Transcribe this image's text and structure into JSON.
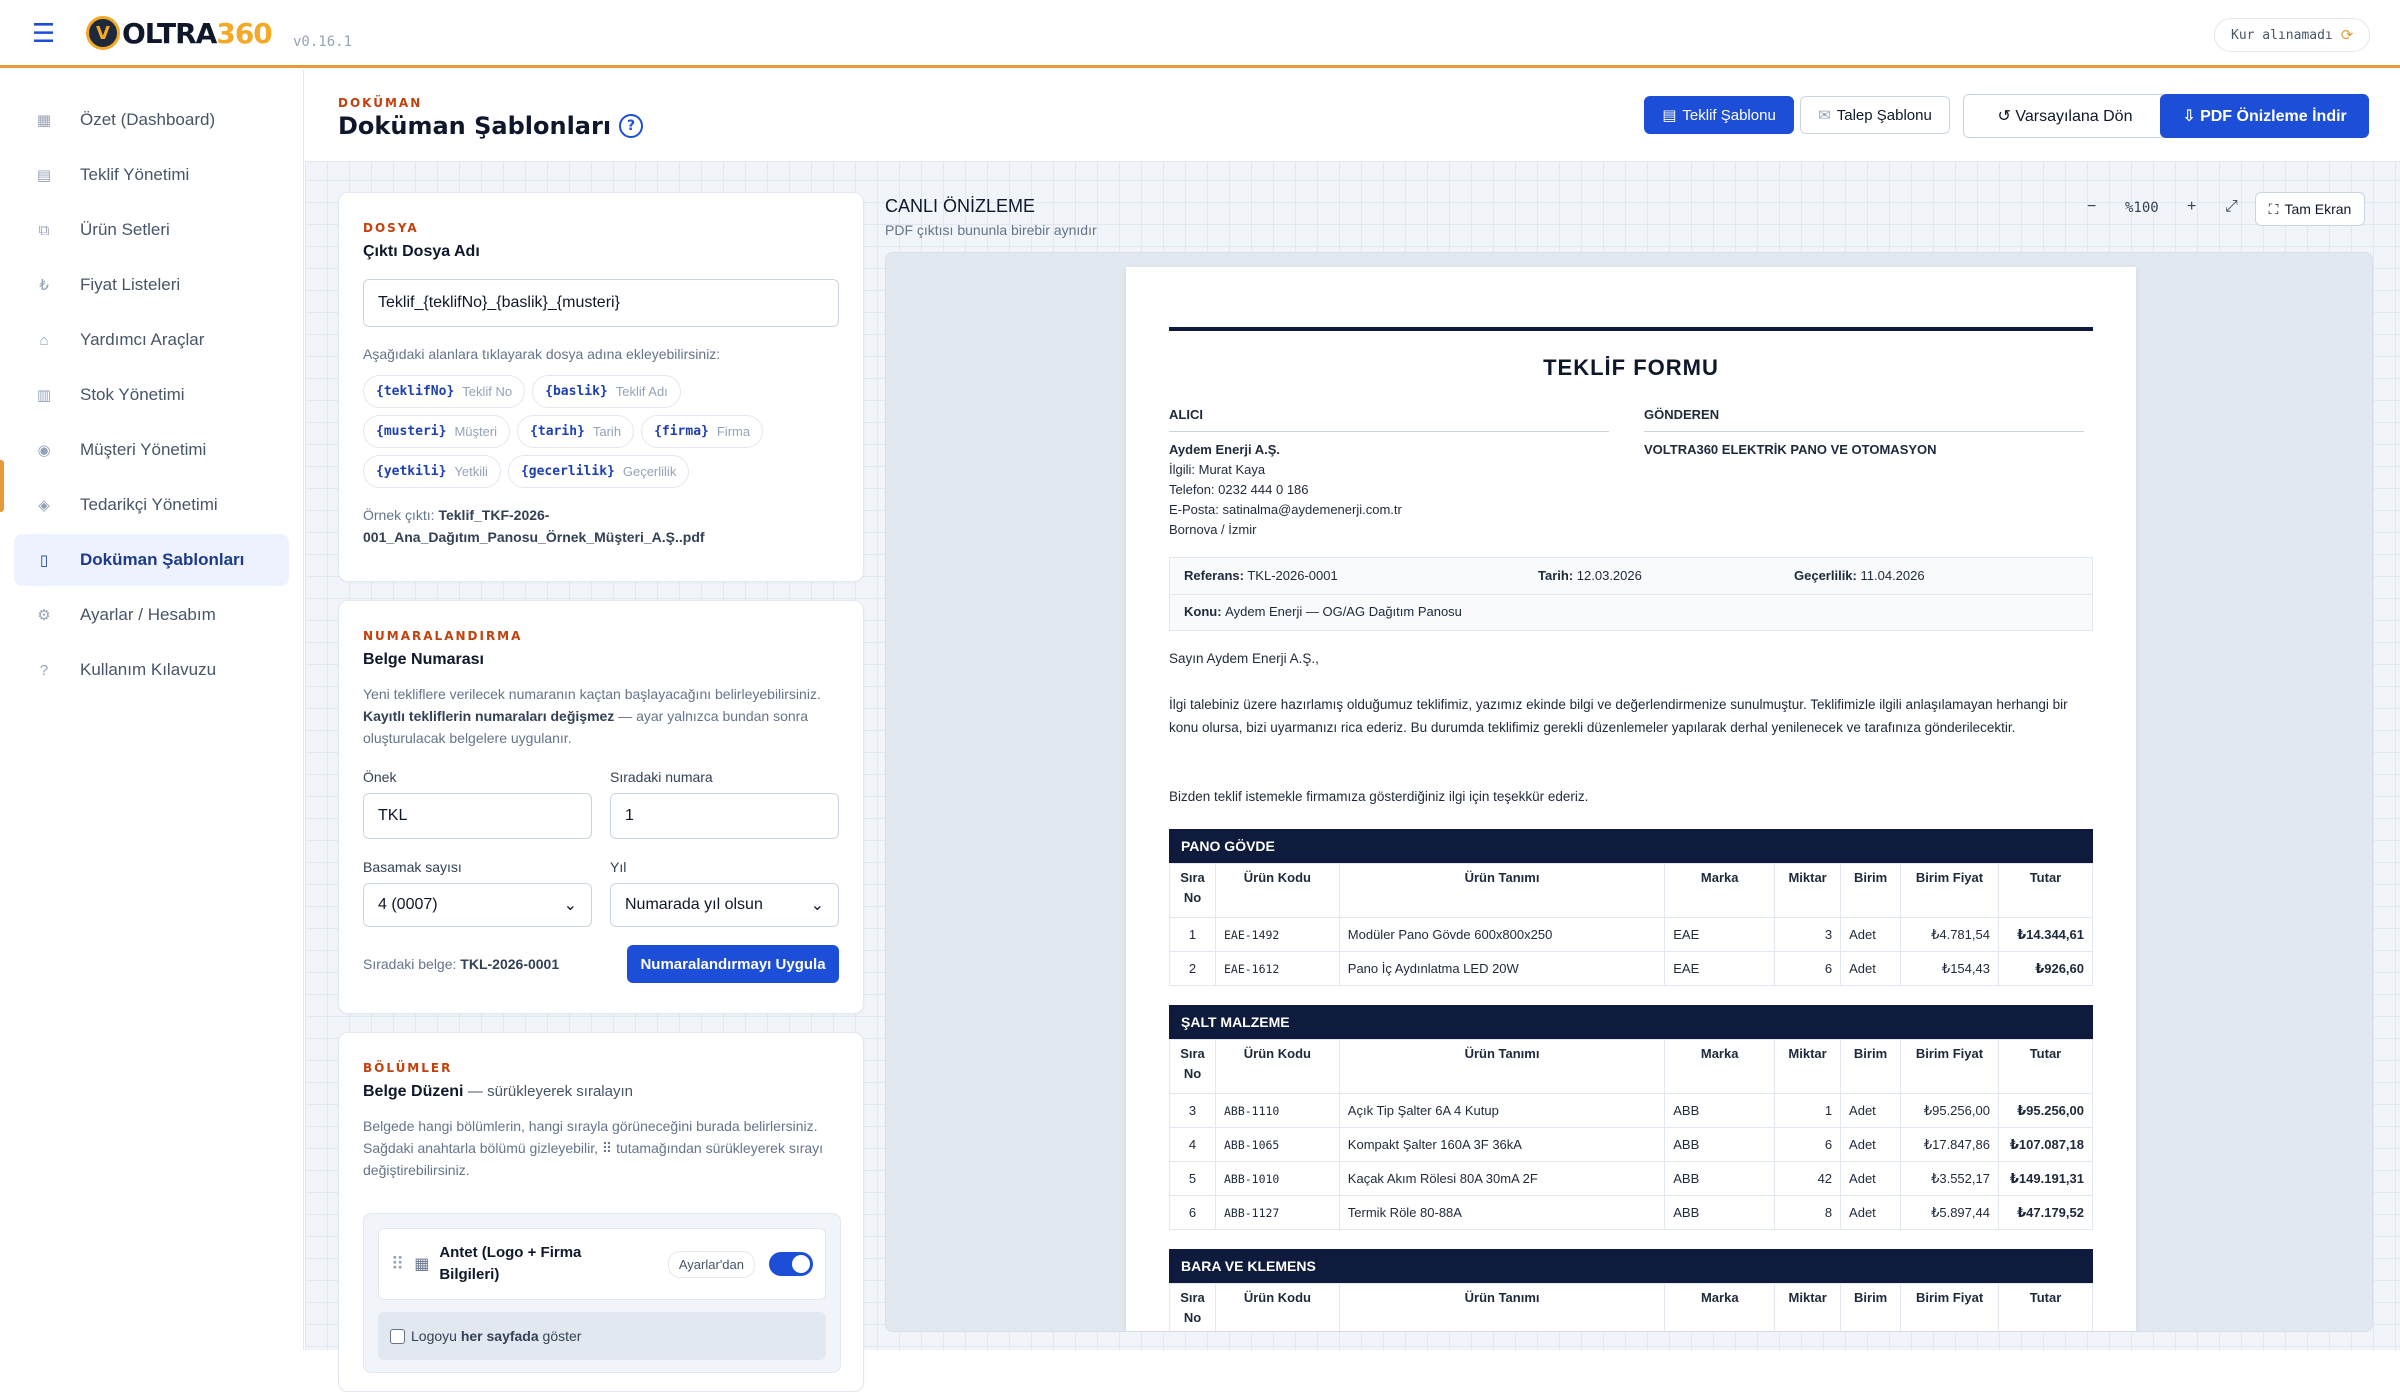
{
  "header": {
    "brand_prefix": "V",
    "brand_main": "OLTRA",
    "brand_num": "360",
    "version": "v0.16.1",
    "kur_status": "Kur alınamadı",
    "kur_icon": "⟳"
  },
  "sidebar": {
    "items": [
      {
        "label": "Özet (Dashboard)",
        "icon": "▦"
      },
      {
        "label": "Teklif Yönetimi",
        "icon": "▤"
      },
      {
        "label": "Ürün Setleri",
        "icon": "⧉"
      },
      {
        "label": "Fiyat Listeleri",
        "icon": "₺"
      },
      {
        "label": "Yardımcı Araçlar",
        "icon": "⌂"
      },
      {
        "label": "Stok Yönetimi",
        "icon": "▥"
      },
      {
        "label": "Müşteri Yönetimi",
        "icon": "◉"
      },
      {
        "label": "Tedarikçi Yönetimi",
        "icon": "◈"
      },
      {
        "label": "Doküman Şablonları",
        "icon": "▯"
      },
      {
        "label": "Ayarlar / Hesabım",
        "icon": "⚙"
      },
      {
        "label": "Kullanım Kılavuzu",
        "icon": "?"
      }
    ]
  },
  "page": {
    "eyebrow": "DOKÜMAN",
    "title": "Doküman Şablonları",
    "help": "?",
    "btn_teklif": "Teklif Şablonu",
    "btn_talep": "Talep Şablonu",
    "btn_reset": "↺ Varsayılana Dön",
    "btn_pdf": "⇩ PDF Önizleme İndir"
  },
  "dosya": {
    "eyebrow": "DOSYA",
    "title": "Çıktı Dosya Adı",
    "value": "Teklif_{teklifNo}_{baslik}_{musteri}",
    "hint": "Aşağıdaki alanlara tıklayarak dosya adına ekleyebilirsiniz:",
    "chips": [
      {
        "key": "{teklifNo}",
        "label": "Teklif No"
      },
      {
        "key": "{baslik}",
        "label": "Teklif Adı"
      },
      {
        "key": "{musteri}",
        "label": "Müşteri"
      },
      {
        "key": "{tarih}",
        "label": "Tarih"
      },
      {
        "key": "{firma}",
        "label": "Firma"
      },
      {
        "key": "{yetkili}",
        "label": "Yetkili"
      },
      {
        "key": "{gecerlilik}",
        "label": "Geçerlilik"
      }
    ],
    "example_label": "Örnek çıktı:",
    "example_value": "Teklif_TKF-2026-001_Ana_Dağıtım_Panosu_Örnek_Müşteri_A.Ş..pdf"
  },
  "numara": {
    "eyebrow": "NUMARALANDIRMA",
    "title": "Belge Numarası",
    "desc1": "Yeni tekliflere verilecek numaranın kaçtan başlayacağını belirleyebilirsiniz.",
    "desc_bold": "Kayıtlı tekliflerin numaraları değişmez",
    "desc2": "— ayar yalnızca bundan sonra oluşturulacak belgelere uygulanır.",
    "onek_label": "Önek",
    "onek_value": "TKL",
    "sira_label": "Sıradaki numara",
    "sira_value": "1",
    "basamak_label": "Basamak sayısı",
    "basamak_value": "4 (0007)",
    "yil_label": "Yıl",
    "yil_value": "Numarada yıl olsun",
    "next_label": "Sıradaki belge:",
    "next_value": "TKL-2026-0001",
    "apply": "Numaralandırmayı Uygula"
  },
  "bolumler": {
    "eyebrow": "BÖLÜMLER",
    "title": "Belge Düzeni",
    "title_suffix": "— sürükleyerek sıralayın",
    "desc": "Belgede hangi bölümlerin, hangi sırayla görüneceğini burada belirlersiniz. Sağdaki anahtarla bölümü gizleyebilir, ⠿ tutamağından sürükleyerek sırayı değiştirebilirsiniz.",
    "section_name": "Antet (Logo + Firma Bilgileri)",
    "section_badge": "Ayarlar'dan",
    "logo_pre": "Logoyu",
    "logo_bold": "her sayfada",
    "logo_post": "göster"
  },
  "preview": {
    "title": "CANLI ÖNİZLEME",
    "subtitle": "PDF çıktısı bununla birebir aynıdır",
    "zoom_out": "−",
    "zoom": "%100",
    "zoom_in": "+",
    "fit": "⤢",
    "fullscreen": "Tam Ekran"
  },
  "doc": {
    "title": "TEKLİF FORMU",
    "alici_h": "ALICI",
    "alici_name": "Aydem Enerji A.Ş.",
    "alici_ilgili": "İlgili: Murat Kaya",
    "alici_tel": "Telefon: 0232 444 0 186",
    "alici_mail": "E-Posta: satinalma@aydemenerji.com.tr",
    "alici_city": "Bornova / İzmir",
    "gonderen_h": "GÖNDEREN",
    "gonderen_name": "VOLTRA360 ELEKTRİK PANO VE OTOMASYON",
    "ref_label": "Referans:",
    "ref_value": "TKL-2026-0001",
    "tarih_label": "Tarih:",
    "tarih_value": "12.03.2026",
    "gec_label": "Geçerlilik:",
    "gec_value": "11.04.2026",
    "konu_label": "Konu:",
    "konu_value": "Aydem Enerji — OG/AG Dağıtım Panosu",
    "salutation": "Sayın Aydem Enerji A.Ş.,",
    "body": "İlgi talebiniz üzere hazırlamış olduğumuz teklifimiz, yazımız ekinde bilgi ve değerlendirmenize sunulmuştur. Teklifimizle ilgili anlaşılamayan herhangi bir konu olursa, bizi uyarmanızı rica ederiz. Bu durumda teklifimiz gerekli düzenlemeler yapılarak derhal yenilenecek ve tarafınıza gönderilecektir.",
    "thanks": "Bizden teklif istemekle firmamıza gösterdiğiniz ilgi için teşekkür ederiz.",
    "cols": [
      "Sıra No",
      "Ürün Kodu",
      "Ürün Tanımı",
      "Marka",
      "Miktar",
      "Birim",
      "Birim Fiyat",
      "Tutar"
    ],
    "groups": [
      {
        "name": "PANO GÖVDE",
        "rows": [
          [
            "1",
            "EAE-1492",
            "Modüler Pano Gövde 600x800x250",
            "EAE",
            "3",
            "Adet",
            "₺4.781,54",
            "₺14.344,61"
          ],
          [
            "2",
            "EAE-1612",
            "Pano İç Aydınlatma LED 20W",
            "EAE",
            "6",
            "Adet",
            "₺154,43",
            "₺926,60"
          ]
        ]
      },
      {
        "name": "ŞALT MALZEME",
        "rows": [
          [
            "3",
            "ABB-1110",
            "Açık Tip Şalter 6A 4 Kutup",
            "ABB",
            "1",
            "Adet",
            "₺95.256,00",
            "₺95.256,00"
          ],
          [
            "4",
            "ABB-1065",
            "Kompakt Şalter 160A 3F 36kA",
            "ABB",
            "6",
            "Adet",
            "₺17.847,86",
            "₺107.087,18"
          ],
          [
            "5",
            "ABB-1010",
            "Kaçak Akım Rölesi 80A 30mA 2F",
            "ABB",
            "42",
            "Adet",
            "₺3.552,17",
            "₺149.191,31"
          ],
          [
            "6",
            "ABB-1127",
            "Termik Röle 80-88A",
            "ABB",
            "8",
            "Adet",
            "₺5.897,44",
            "₺47.179,52"
          ]
        ]
      },
      {
        "name": "BARA VE KLEMENS",
        "rows": []
      }
    ]
  }
}
